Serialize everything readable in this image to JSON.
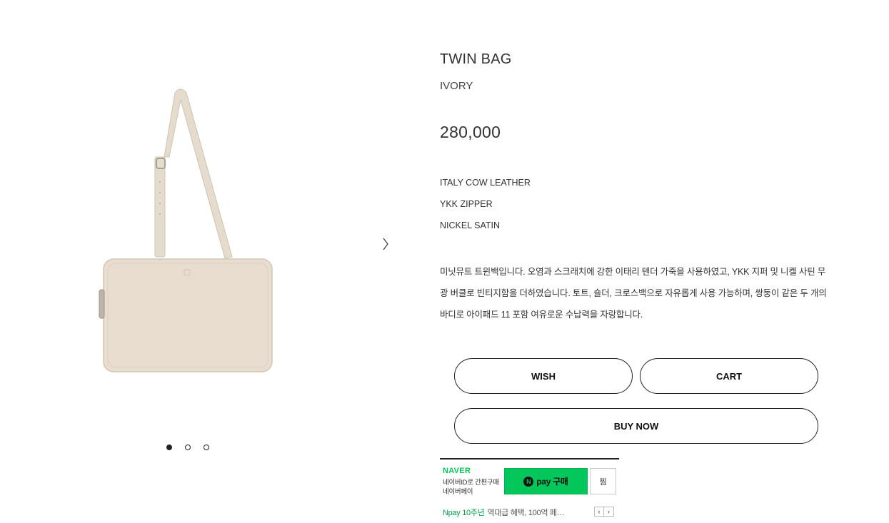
{
  "gallery": {
    "image_alt": "Twin bag ivory product image",
    "next_icon": "chevron-right-icon",
    "slides": 3,
    "active_slide": 1
  },
  "product": {
    "title": "TWIN BAG",
    "color": "IVORY",
    "price": "280,000",
    "specs": [
      "ITALY COW LEATHER",
      "YKK ZIPPER",
      "NICKEL SATIN"
    ],
    "description": "미닛뮤트 트윈백입니다. 오염과 스크래치에 강한 이태리 텐더 가죽을 사용하였고, YKK 지퍼 및 니켈 사틴 무광 버클로 빈티지함을 더하였습니다. 토트, 숄더, 크로스백으로 자유롭게 사용 가능하며, 쌍둥이 같은 두 개의 바디로 아이패드 11 포함 여유로운 수납력을 자랑합니다."
  },
  "actions": {
    "wish": "WISH",
    "cart": "CART",
    "buy_now": "BUY NOW"
  },
  "naver_pay": {
    "brand": "NAVER",
    "sub1": "네이버ID로 간편구매",
    "sub2": "네이버페이",
    "n_glyph": "N",
    "buy_label": "pay 구매",
    "zzim_label": "찜",
    "promo_highlight": "Npay 10주년",
    "promo_text": "역대급 혜택, 100억 페…",
    "prev_glyph": "‹",
    "next_glyph": "›"
  },
  "colors": {
    "bag": "#e8ddcf",
    "naver_green": "#03c75a",
    "text": "#333333"
  }
}
